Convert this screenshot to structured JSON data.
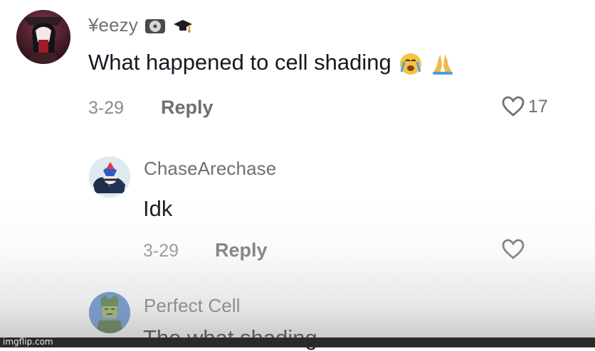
{
  "comments": [
    {
      "username": "¥eezy",
      "text": "What happened to cell shading",
      "date": "3-29",
      "reply_label": "Reply",
      "like_count": "17",
      "username_icons": [
        "cd-icon",
        "graduation-cap-icon"
      ],
      "text_icons": [
        "crying-face-icon",
        "praying-hands-icon"
      ]
    },
    {
      "username": "ChaseArechase",
      "text": "Idk",
      "date": "3-29",
      "reply_label": "Reply",
      "like_count": ""
    },
    {
      "username": "Perfect Cell",
      "text": "The what shading"
    }
  ],
  "watermark": "imgflip.com",
  "colors": {
    "username_gray": "#6f7074",
    "date_gray": "#8a8b91",
    "text_dark": "#161823"
  }
}
